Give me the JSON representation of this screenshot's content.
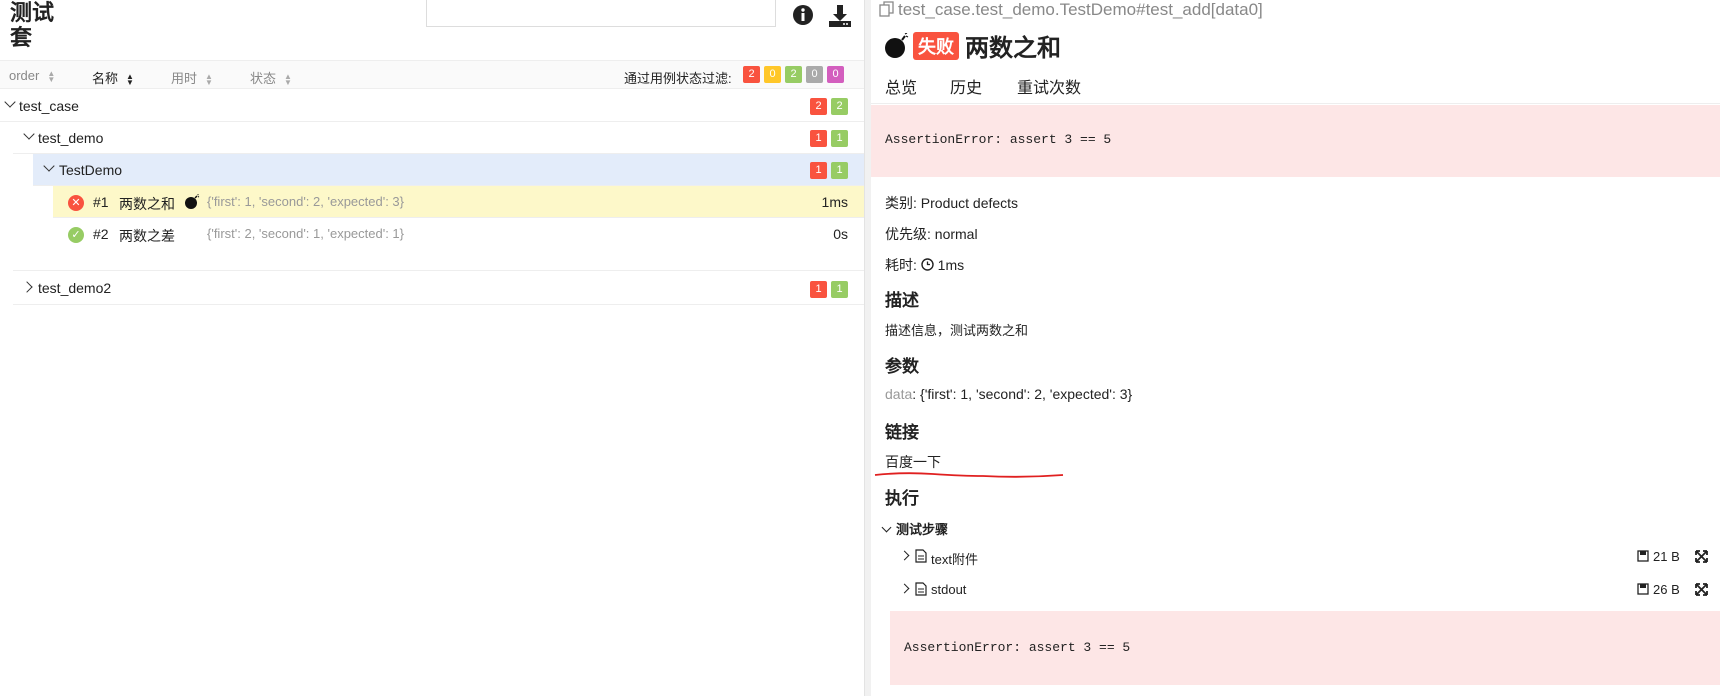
{
  "left": {
    "suite_title": "测试套",
    "sort": {
      "order": "order",
      "name": "名称",
      "duration": "用时",
      "status": "状态",
      "filter_label": "通过用例状态过滤:",
      "filter_counts": [
        "2",
        "0",
        "2",
        "0",
        "0"
      ]
    },
    "tree": {
      "test_case": {
        "label": "test_case",
        "failed": "2",
        "passed": "2"
      },
      "test_demo": {
        "label": "test_demo",
        "failed": "1",
        "passed": "1"
      },
      "TestDemo": {
        "label": "TestDemo",
        "failed": "1",
        "passed": "1"
      },
      "case1": {
        "num": "#1",
        "name": "两数之和",
        "params": "{'first': 1, 'second': 2, 'expected': 3}",
        "duration": "1ms"
      },
      "case2": {
        "num": "#2",
        "name": "两数之差",
        "params": "{'first': 2, 'second': 1, 'expected': 1}",
        "duration": "0s"
      },
      "test_demo2": {
        "label": "test_demo2",
        "failed": "1",
        "passed": "1"
      }
    }
  },
  "right": {
    "breadcrumb": "test_case.test_demo.TestDemo#test_add[data0]",
    "fail_tag": "失败",
    "title": "两数之和",
    "tabs": [
      "总览",
      "历史",
      "重试次数"
    ],
    "error_message": "AssertionError: assert 3 == 5",
    "category_label": "类别:",
    "category_value": "Product defects",
    "severity_label": "优先级:",
    "severity_value": "normal",
    "duration_label": "耗时:",
    "duration_value": "1ms",
    "description_h": "描述",
    "description_text": "描述信息，测试两数之和",
    "params_h": "参数",
    "param_key": "data",
    "param_value": ": {'first': 1, 'second': 2, 'expected': 3}",
    "links_h": "链接",
    "link_text": "百度一下",
    "execution_h": "执行",
    "steps_label": "测试步骤",
    "attachments": [
      {
        "name": "text附件",
        "size": "21 B"
      },
      {
        "name": "stdout",
        "size": "26 B"
      }
    ],
    "stdout_content": "AssertionError: assert 3 == 5"
  }
}
